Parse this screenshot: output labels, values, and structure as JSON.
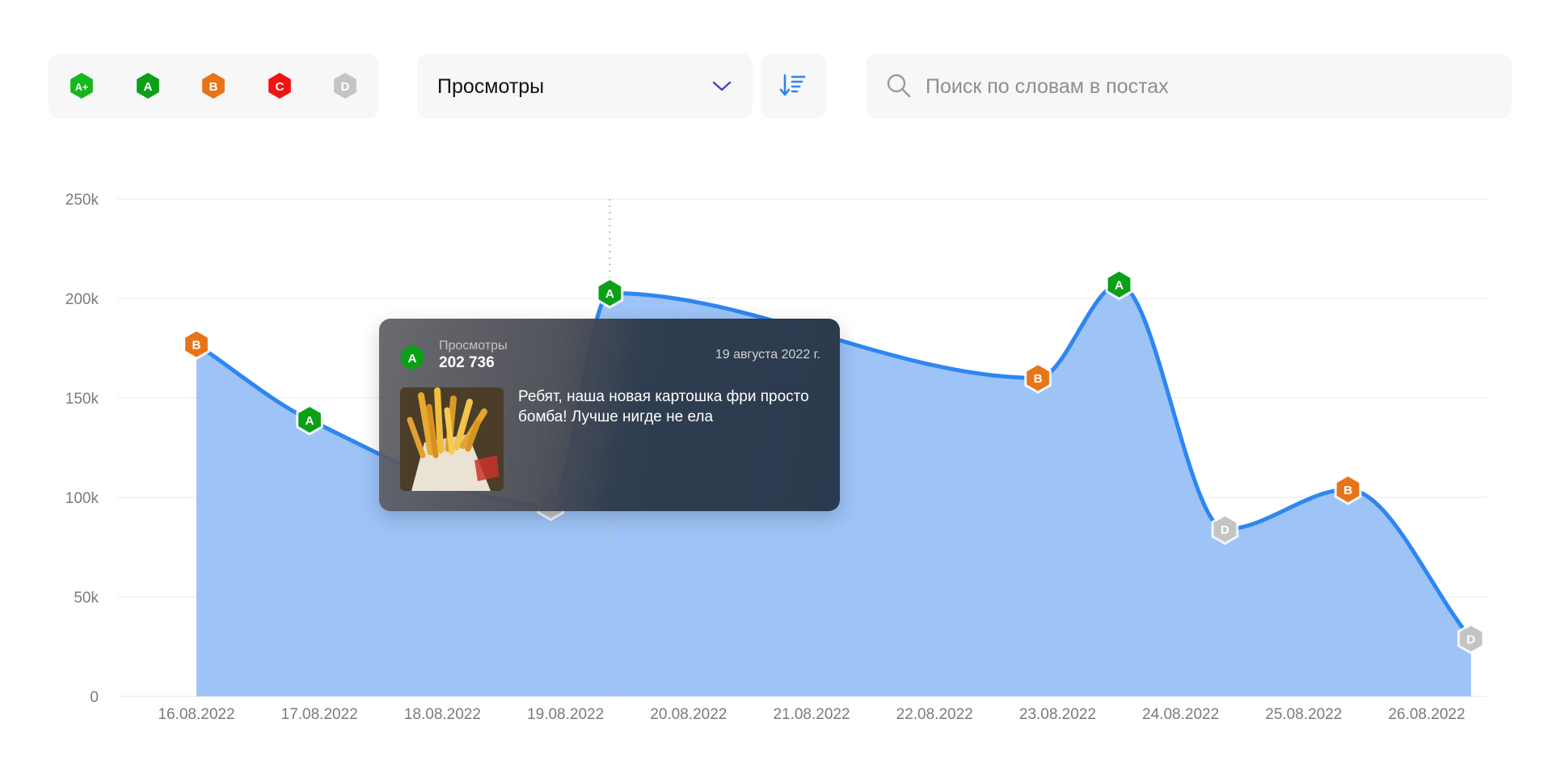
{
  "filters": {
    "grades": [
      {
        "label": "A+",
        "color": "#12b81c"
      },
      {
        "label": "A",
        "color": "#0ca016"
      },
      {
        "label": "B",
        "color": "#e8741a"
      },
      {
        "label": "C",
        "color": "#f01414"
      },
      {
        "label": "D",
        "color": "#c4c4c4"
      }
    ],
    "metric_select": {
      "value": "Просмотры"
    },
    "sort_icon": "sort-descending-icon",
    "search": {
      "placeholder": "Поиск по словам в постах",
      "value": "",
      "icon": "search-icon"
    }
  },
  "colors": {
    "line": "#2e86f2",
    "area": "#9dc3f7",
    "grid": "#ececec",
    "accent": "#3d48c2"
  },
  "chart_data": {
    "type": "area",
    "title": "",
    "ylabel": "",
    "xlabel": "",
    "ylim": [
      0,
      250000
    ],
    "y_ticks": [
      "0",
      "50k",
      "100k",
      "150k",
      "200k",
      "250k"
    ],
    "x_ticks": [
      "16.08.2022",
      "17.08.2022",
      "18.08.2022",
      "19.08.2022",
      "20.08.2022",
      "21.08.2022",
      "22.08.2022",
      "23.08.2022",
      "24.08.2022",
      "25.08.2022",
      "26.08.2022"
    ],
    "grid": true,
    "series": [
      {
        "values": [
          {
            "t": 0.0,
            "y": 177000,
            "grade": "B"
          },
          {
            "t": 0.92,
            "y": 139000,
            "grade": "A"
          },
          {
            "t": 2.88,
            "y": 96000,
            "grade": "D"
          },
          {
            "t": 3.36,
            "y": 202736,
            "grade": "A"
          },
          {
            "t": 6.84,
            "y": 160000,
            "grade": "B"
          },
          {
            "t": 7.5,
            "y": 207000,
            "grade": "A"
          },
          {
            "t": 8.36,
            "y": 84000,
            "grade": "D"
          },
          {
            "t": 9.36,
            "y": 104000,
            "grade": "B"
          },
          {
            "t": 10.36,
            "y": 29000,
            "grade": "D"
          }
        ]
      }
    ]
  },
  "tooltip": {
    "metric": "Просмотры",
    "value": "202 736",
    "grade": "A",
    "date": "19 августа 2022 г.",
    "post_text": "Ребят, наша новая картошка фри просто бомба! Лучше нигде не ела"
  }
}
